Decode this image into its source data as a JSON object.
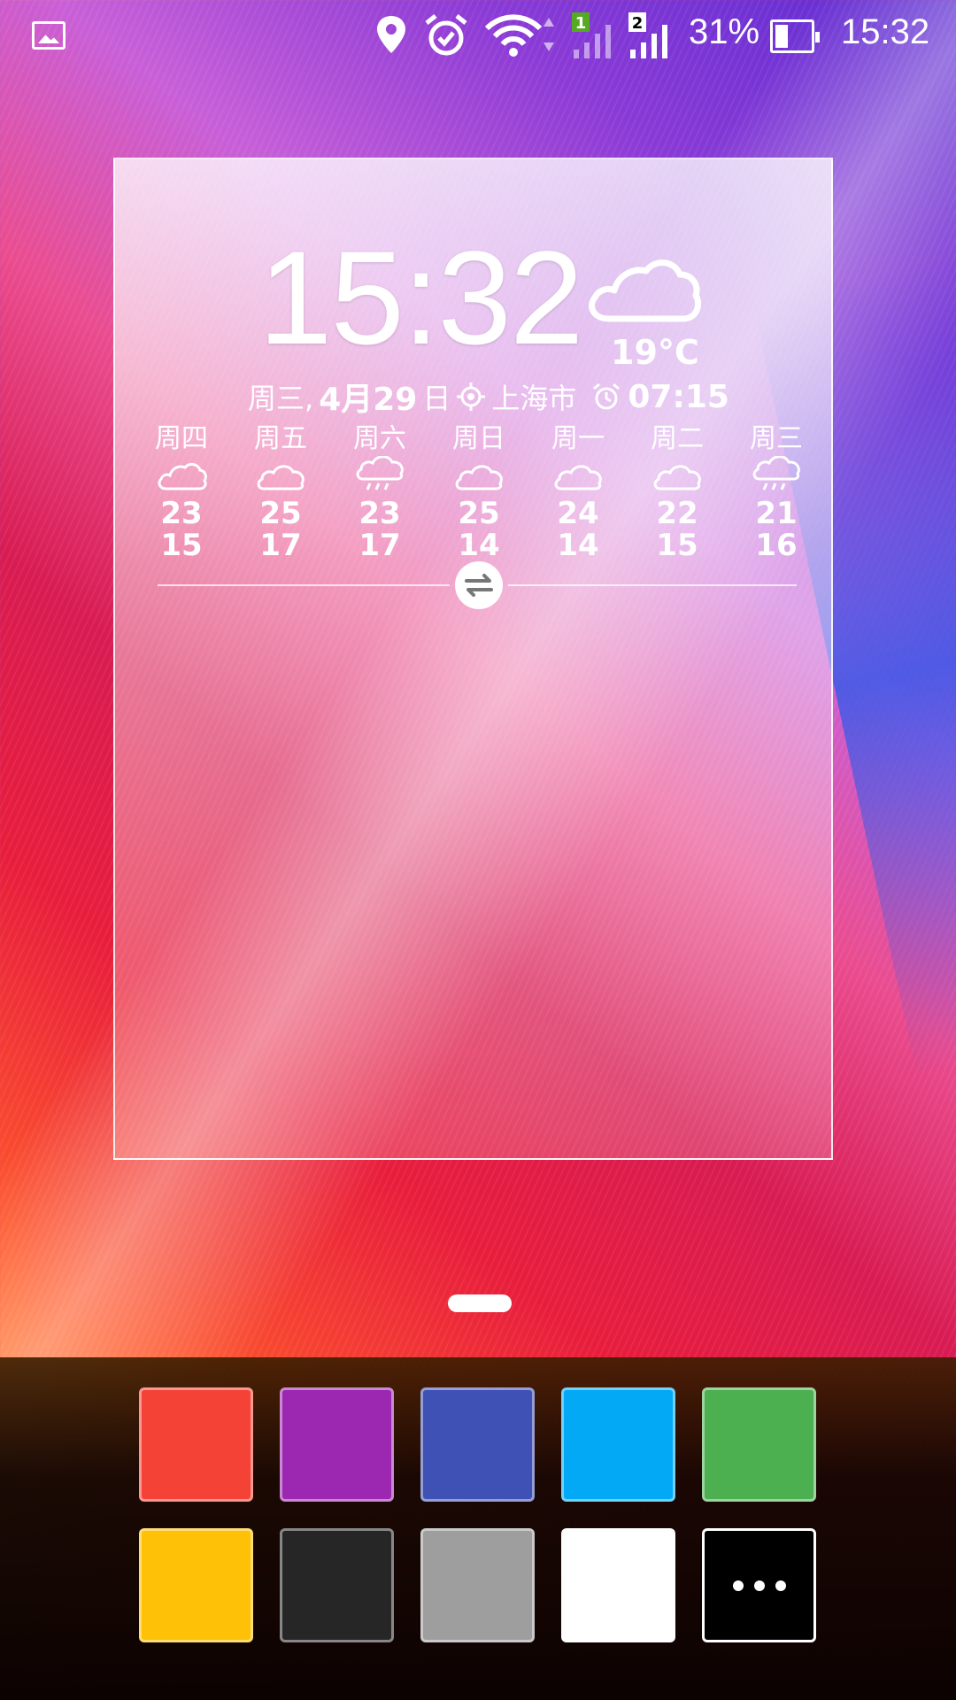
{
  "status_bar": {
    "sim1": "1",
    "sim2": "2",
    "battery_percent_text": "31%",
    "battery_level": 0.31,
    "time": "15:32"
  },
  "widget": {
    "time": "15:32",
    "current_temp": "19°C",
    "weekday": "周三,",
    "date": "4月29",
    "day_suffix": "日",
    "city": "上海市",
    "alarm_time": "07:15",
    "forecast": [
      {
        "day": "周四",
        "icon": "cloudy-icon",
        "hi": "23",
        "lo": "15"
      },
      {
        "day": "周五",
        "icon": "cloud-icon",
        "hi": "25",
        "lo": "17"
      },
      {
        "day": "周六",
        "icon": "rain-icon",
        "hi": "23",
        "lo": "17"
      },
      {
        "day": "周日",
        "icon": "cloud-icon",
        "hi": "25",
        "lo": "14"
      },
      {
        "day": "周一",
        "icon": "cloud-icon",
        "hi": "24",
        "lo": "14"
      },
      {
        "day": "周二",
        "icon": "cloud-icon",
        "hi": "22",
        "lo": "15"
      },
      {
        "day": "周三",
        "icon": "rain-icon",
        "hi": "21",
        "lo": "16"
      }
    ]
  },
  "palette": {
    "colors": [
      "#f44336",
      "#9c27b0",
      "#3f51b5",
      "#03a9f4",
      "#4caf50",
      "#ffc107",
      "#262626",
      "#9e9e9e",
      "#ffffff"
    ]
  }
}
